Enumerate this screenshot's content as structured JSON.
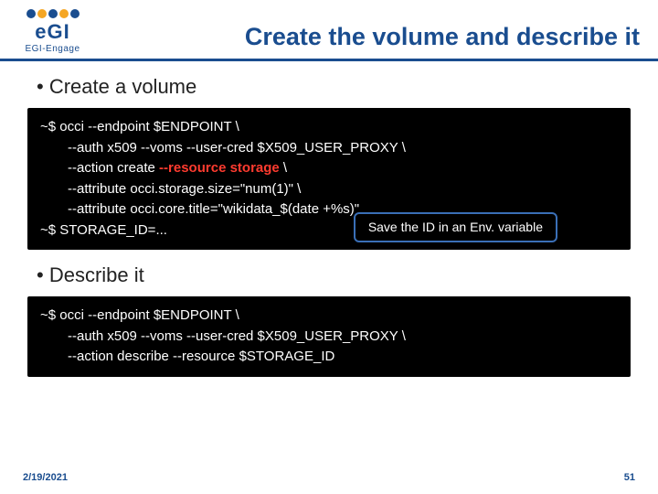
{
  "logo": {
    "brand": "eGI",
    "sub": "EGI-Engage"
  },
  "title": "Create the volume and describe it",
  "bullet1": "Create a volume",
  "code1": {
    "l1": "~$ occi --endpoint $ENDPOINT \\",
    "l2a": "--auth x509 --voms --user-cred $X509_USER_PROXY \\",
    "l3a": "--action create ",
    "l3b": "--resource storage",
    "l3c": " \\",
    "l4a": "--attribute occi.storage.size=\"num(1)\" \\",
    "l5a": "--attribute occi.core.title=\"wikidata_$(date +%s)\"",
    "l6": "~$ STORAGE_ID=...",
    "callout": "Save the ID in an Env. variable"
  },
  "bullet2": "Describe it",
  "code2": {
    "l1": "~$ occi --endpoint $ENDPOINT \\",
    "l2a": "--auth x509 --voms --user-cred $X509_USER_PROXY \\",
    "l3a": "--action describe --resource $STORAGE_ID"
  },
  "footer": {
    "date": "2/19/2021",
    "page": "51"
  }
}
